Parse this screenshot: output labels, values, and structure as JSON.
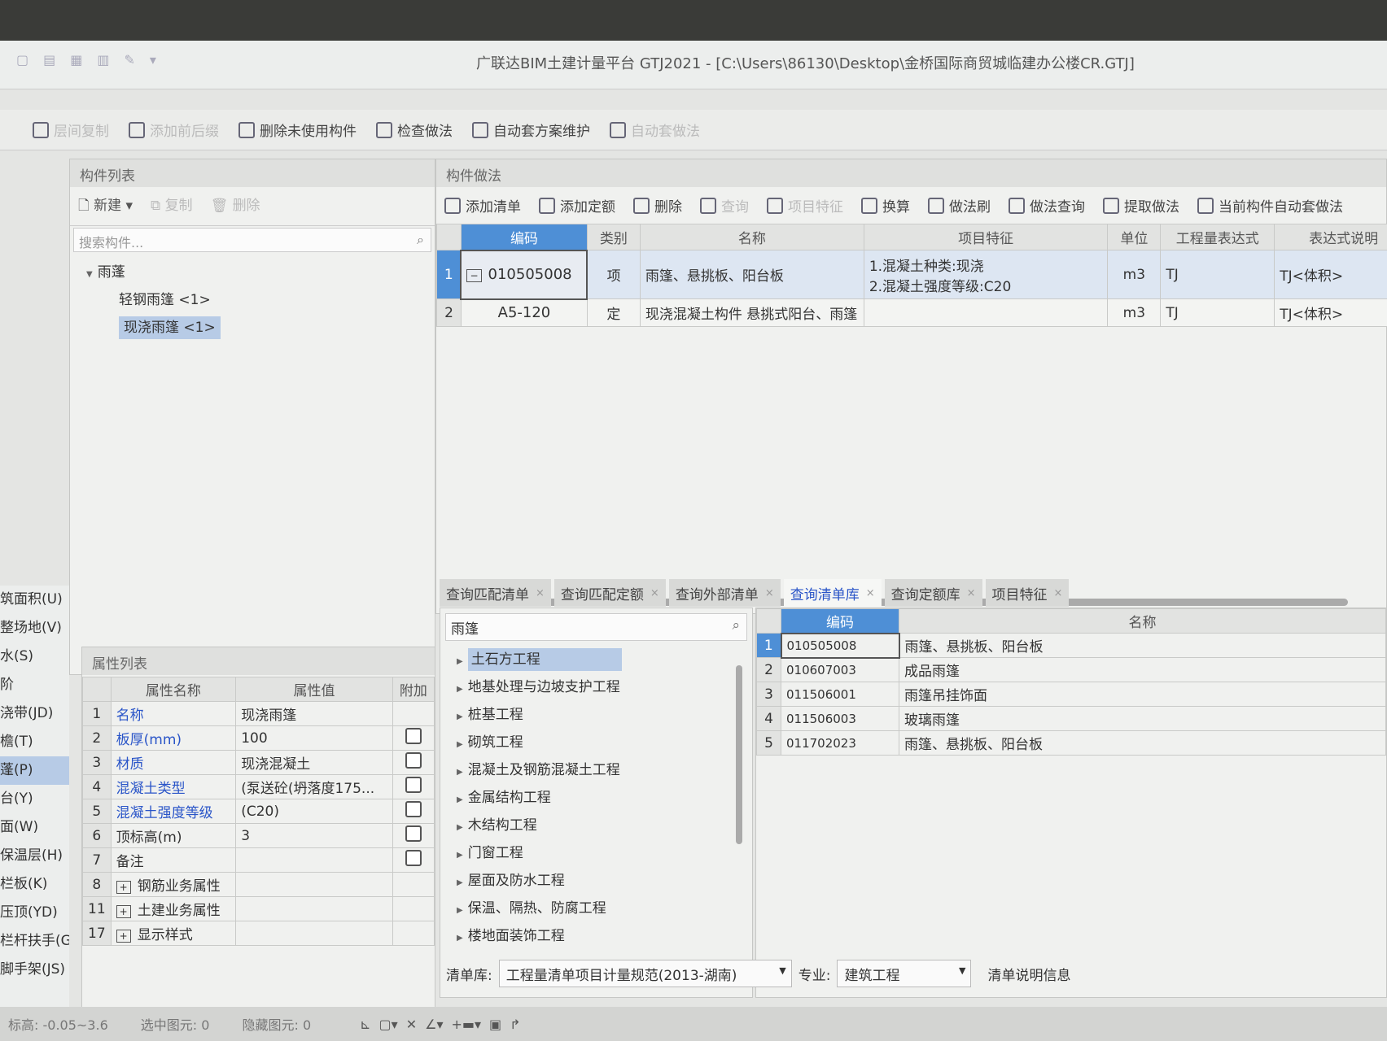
{
  "window": {
    "title": "广联达BIM土建计量平台 GTJ2021 - [C:\\Users\\86130\\Desktop\\金桥国际商贸城临建办公楼CR.GTJ]"
  },
  "toolbar": {
    "items": [
      {
        "label": "层间复制",
        "icon": "copy-icon",
        "enabled": false
      },
      {
        "label": "添加前后缀",
        "icon": "prefix-icon",
        "enabled": false
      },
      {
        "label": "删除未使用构件",
        "icon": "delete-unused-icon",
        "enabled": true
      },
      {
        "label": "检查做法",
        "icon": "check-icon",
        "enabled": true
      },
      {
        "label": "自动套方案维护",
        "icon": "auto-icon",
        "enabled": true
      },
      {
        "label": "自动套做法",
        "icon": "auto-apply-icon",
        "enabled": false
      }
    ]
  },
  "nav": {
    "items": [
      "筑面积(U)",
      "整场地(V)",
      "水(S)",
      "阶",
      "浇带(JD)",
      "檐(T)",
      "蓬(P)",
      "台(Y)",
      "面(W)",
      "保温层(H)",
      "栏板(K)",
      "压顶(YD)",
      "栏杆扶手(G)",
      "脚手架(JS)"
    ],
    "selected": 6
  },
  "component_list": {
    "title": "构件列表",
    "new": "新建",
    "copy": "复制",
    "delete": "删除",
    "search_placeholder": "搜索构件...",
    "tree": {
      "group": "雨蓬",
      "children": [
        "轻钢雨篷 <1>",
        "现浇雨篷 <1>"
      ],
      "selected": 1
    }
  },
  "properties": {
    "title": "属性列表",
    "headers": [
      "属性名称",
      "属性值",
      "附加"
    ],
    "rows": [
      {
        "n": "1",
        "name": "名称",
        "value": "现浇雨篷",
        "link": true,
        "cb": false
      },
      {
        "n": "2",
        "name": "板厚(mm)",
        "value": "100",
        "link": true,
        "cb": true
      },
      {
        "n": "3",
        "name": "材质",
        "value": "现浇混凝土",
        "link": true,
        "cb": true
      },
      {
        "n": "4",
        "name": "混凝土类型",
        "value": "(泵送砼(坍落度175...",
        "link": true,
        "cb": true
      },
      {
        "n": "5",
        "name": "混凝土强度等级",
        "value": "(C20)",
        "link": true,
        "cb": true
      },
      {
        "n": "6",
        "name": "顶标高(m)",
        "value": "3",
        "link": false,
        "cb": true
      },
      {
        "n": "7",
        "name": "备注",
        "value": "",
        "link": false,
        "cb": true
      },
      {
        "n": "8",
        "name": "钢筋业务属性",
        "value": "",
        "link": false,
        "cb": false,
        "expand": true
      },
      {
        "n": "11",
        "name": "土建业务属性",
        "value": "",
        "link": false,
        "cb": false,
        "expand": true
      },
      {
        "n": "17",
        "name": "显示样式",
        "value": "",
        "link": false,
        "cb": false,
        "expand": true
      }
    ]
  },
  "method": {
    "title": "构件做法",
    "toolbar": [
      "添加清单",
      "添加定额",
      "删除",
      "查询",
      "项目特征",
      "换算",
      "做法刷",
      "做法查询",
      "提取做法",
      "当前构件自动套做法"
    ],
    "headers": [
      "编码",
      "类别",
      "名称",
      "项目特征",
      "单位",
      "工程量表达式",
      "表达式说明"
    ],
    "rows": [
      {
        "n": "1",
        "code": "010505008",
        "type": "项",
        "name": "雨篷、悬挑板、阳台板",
        "feature": [
          "1.混凝土种类:现浇",
          "2.混凝土强度等级:C20"
        ],
        "unit": "m3",
        "expr": "TJ",
        "desc": "TJ<体积>"
      },
      {
        "n": "2",
        "code": "A5-120",
        "type": "定",
        "name": "现浇混凝土构件 悬挑式阳台、雨篷",
        "feature": [],
        "unit": "m3",
        "expr": "TJ",
        "desc": "TJ<体积>"
      }
    ]
  },
  "query": {
    "tabs": [
      "查询匹配清单",
      "查询匹配定额",
      "查询外部清单",
      "查询清单库",
      "查询定额库",
      "项目特征"
    ],
    "active_tab": 3,
    "search_value": "雨篷",
    "tree": [
      "土石方工程",
      "地基处理与边坡支护工程",
      "桩基工程",
      "砌筑工程",
      "混凝土及钢筋混凝土工程",
      "金属结构工程",
      "木结构工程",
      "门窗工程",
      "屋面及防水工程",
      "保温、隔热、防腐工程",
      "楼地面装饰工程"
    ],
    "tree_selected": 0,
    "headers": [
      "编码",
      "名称"
    ],
    "rows": [
      [
        "1",
        "010505008",
        "雨篷、悬挑板、阳台板"
      ],
      [
        "2",
        "010607003",
        "成品雨篷"
      ],
      [
        "3",
        "011506001",
        "雨篷吊挂饰面"
      ],
      [
        "4",
        "011506003",
        "玻璃雨篷"
      ],
      [
        "5",
        "011702023",
        "雨篷、悬挑板、阳台板"
      ]
    ],
    "lib_label": "清单库:",
    "lib_value": "工程量清单项目计量规范(2013-湖南)",
    "spec_label": "专业:",
    "spec_value": "建筑工程",
    "info_label": "清单说明信息"
  },
  "status": {
    "elev_label": "标高:",
    "elev": "-0.05~3.6",
    "selected_label": "选中图元:",
    "selected": "0",
    "hidden_label": "隐藏图元:",
    "hidden": "0"
  },
  "colors": {
    "accent": "#4e8fd6",
    "selection": "#b7cbe6",
    "link": "#2a55c8"
  }
}
